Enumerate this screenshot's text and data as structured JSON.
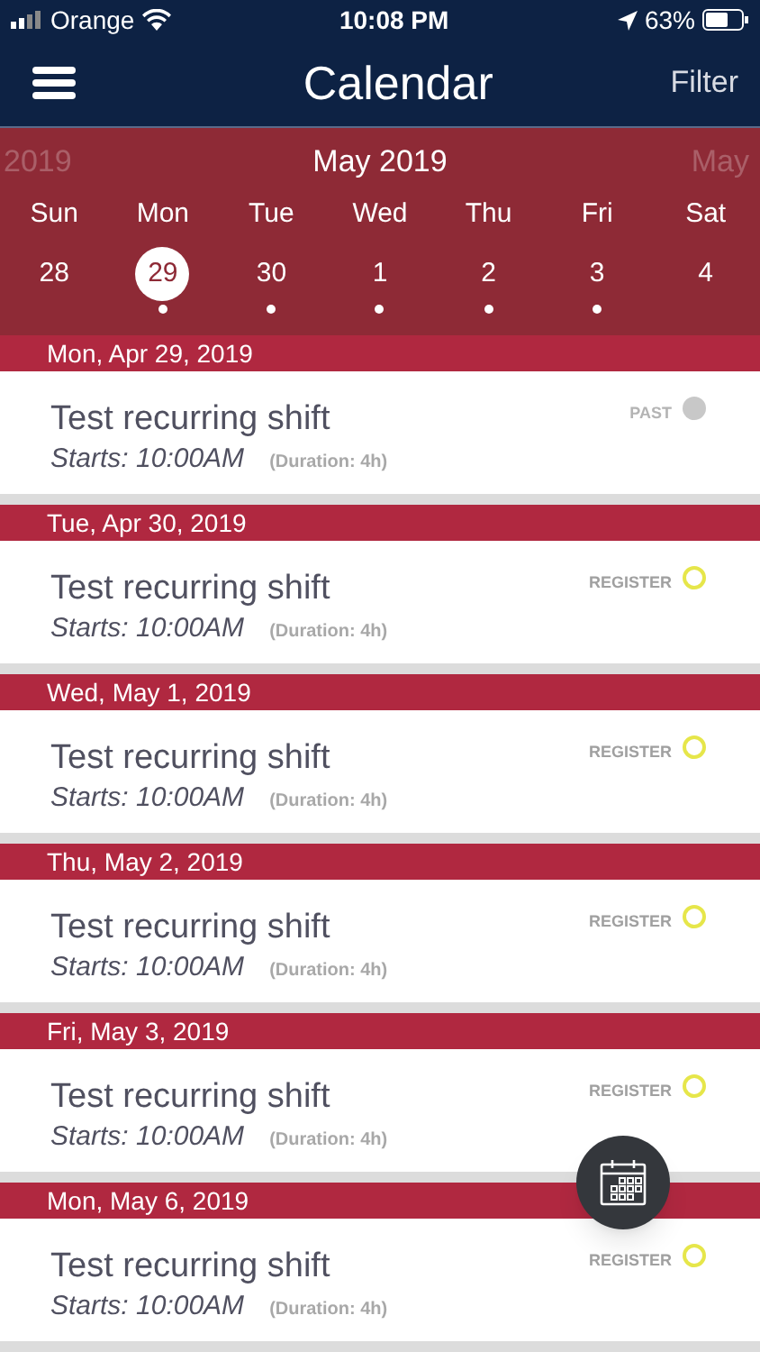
{
  "status_bar": {
    "carrier": "Orange",
    "time": "10:08 PM",
    "battery": "63%"
  },
  "nav": {
    "title": "Calendar",
    "action": "Filter"
  },
  "calendar": {
    "prev_label": "2019",
    "month": "May 2019",
    "next_label": "May",
    "weekdays": [
      "Sun",
      "Mon",
      "Tue",
      "Wed",
      "Thu",
      "Fri",
      "Sat"
    ],
    "days": [
      {
        "date": "28",
        "selected": false,
        "has_events": false
      },
      {
        "date": "29",
        "selected": true,
        "has_events": true
      },
      {
        "date": "30",
        "selected": false,
        "has_events": true
      },
      {
        "date": "1",
        "selected": false,
        "has_events": true
      },
      {
        "date": "2",
        "selected": false,
        "has_events": true
      },
      {
        "date": "3",
        "selected": false,
        "has_events": true
      },
      {
        "date": "4",
        "selected": false,
        "has_events": false
      }
    ]
  },
  "sections": [
    {
      "header": "Mon, Apr 29, 2019",
      "shift": {
        "title": "Test recurring shift",
        "starts": "Starts: 10:00AM",
        "duration": "(Duration: 4h)",
        "kind": "past",
        "status_label": "PAST"
      }
    },
    {
      "header": "Tue, Apr 30, 2019",
      "shift": {
        "title": "Test recurring shift",
        "starts": "Starts: 10:00AM",
        "duration": "(Duration: 4h)",
        "kind": "register",
        "status_label": "REGISTER"
      }
    },
    {
      "header": "Wed, May 1, 2019",
      "shift": {
        "title": "Test recurring shift",
        "starts": "Starts: 10:00AM",
        "duration": "(Duration: 4h)",
        "kind": "register",
        "status_label": "REGISTER"
      }
    },
    {
      "header": "Thu, May 2, 2019",
      "shift": {
        "title": "Test recurring shift",
        "starts": "Starts: 10:00AM",
        "duration": "(Duration: 4h)",
        "kind": "register",
        "status_label": "REGISTER"
      }
    },
    {
      "header": "Fri, May 3, 2019",
      "shift": {
        "title": "Test recurring shift",
        "starts": "Starts: 10:00AM",
        "duration": "(Duration: 4h)",
        "kind": "register",
        "status_label": "REGISTER"
      }
    },
    {
      "header": "Mon, May 6, 2019",
      "shift": {
        "title": "Test recurring shift",
        "starts": "Starts: 10:00AM",
        "duration": "(Duration: 4h)",
        "kind": "register",
        "status_label": "REGISTER"
      }
    }
  ]
}
